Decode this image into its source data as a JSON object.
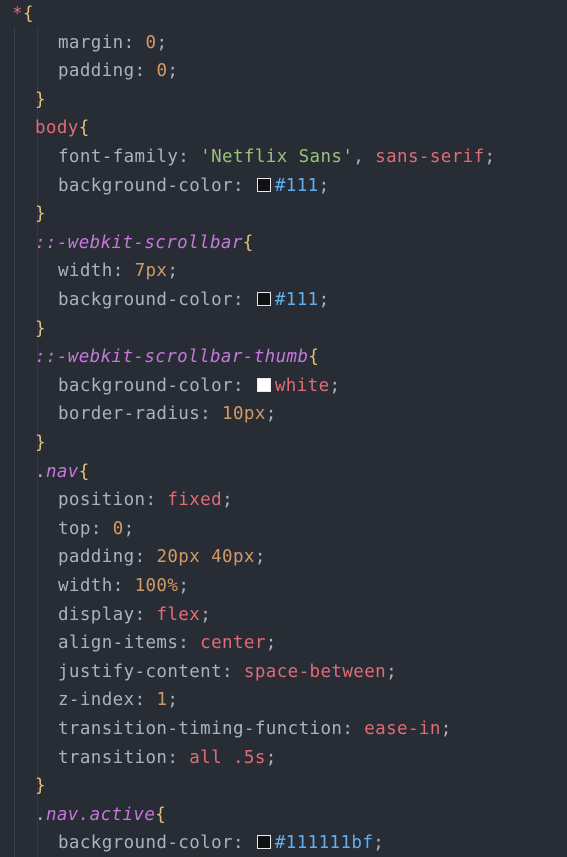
{
  "lines": [
    {
      "indent": 0,
      "tokens": [
        {
          "t": "*",
          "c": "sel-star"
        },
        {
          "t": "{",
          "c": "brace"
        }
      ]
    },
    {
      "indent": 1,
      "tokens": [
        {
          "t": "margin",
          "c": "prop"
        },
        {
          "t": ": ",
          "c": "punc"
        },
        {
          "t": "0",
          "c": "num"
        },
        {
          "t": ";",
          "c": "punc"
        }
      ]
    },
    {
      "indent": 1,
      "tokens": [
        {
          "t": "padding",
          "c": "prop"
        },
        {
          "t": ": ",
          "c": "punc"
        },
        {
          "t": "0",
          "c": "num"
        },
        {
          "t": ";",
          "c": "punc"
        }
      ]
    },
    {
      "indent": 0,
      "tokens": [
        {
          "t": "}",
          "c": "brace"
        }
      ]
    },
    {
      "indent": 0,
      "tokens": [
        {
          "t": "body",
          "c": "sel-tag"
        },
        {
          "t": "{",
          "c": "brace"
        }
      ]
    },
    {
      "indent": 1,
      "tokens": [
        {
          "t": "font-family",
          "c": "prop"
        },
        {
          "t": ": ",
          "c": "punc"
        },
        {
          "t": "'Netflix Sans'",
          "c": "str"
        },
        {
          "t": ", ",
          "c": "punc"
        },
        {
          "t": "sans-serif",
          "c": "kw"
        },
        {
          "t": ";",
          "c": "punc"
        }
      ]
    },
    {
      "indent": 1,
      "tokens": [
        {
          "t": "background-color",
          "c": "prop"
        },
        {
          "t": ": ",
          "c": "punc"
        },
        {
          "swatch": "#111111"
        },
        {
          "t": "#111",
          "c": "hex"
        },
        {
          "t": ";",
          "c": "punc"
        }
      ]
    },
    {
      "indent": 0,
      "tokens": [
        {
          "t": "}",
          "c": "brace"
        }
      ]
    },
    {
      "indent": 0,
      "tokens": [
        {
          "t": "::-webkit-scrollbar",
          "c": "sel-pseudo"
        },
        {
          "t": "{",
          "c": "brace"
        }
      ]
    },
    {
      "indent": 1,
      "tokens": [
        {
          "t": "width",
          "c": "prop"
        },
        {
          "t": ": ",
          "c": "punc"
        },
        {
          "t": "7px",
          "c": "num"
        },
        {
          "t": ";",
          "c": "punc"
        }
      ]
    },
    {
      "indent": 1,
      "tokens": [
        {
          "t": "background-color",
          "c": "prop"
        },
        {
          "t": ": ",
          "c": "punc"
        },
        {
          "swatch": "#111111"
        },
        {
          "t": "#111",
          "c": "hex"
        },
        {
          "t": ";",
          "c": "punc"
        }
      ]
    },
    {
      "indent": 0,
      "tokens": [
        {
          "t": "}",
          "c": "brace"
        }
      ]
    },
    {
      "indent": 0,
      "tokens": [
        {
          "t": "::-webkit-scrollbar-thumb",
          "c": "sel-pseudo"
        },
        {
          "t": "{",
          "c": "brace"
        }
      ]
    },
    {
      "indent": 1,
      "tokens": [
        {
          "t": "background-color",
          "c": "prop"
        },
        {
          "t": ": ",
          "c": "punc"
        },
        {
          "swatch": "#ffffff"
        },
        {
          "t": "white",
          "c": "kw"
        },
        {
          "t": ";",
          "c": "punc"
        }
      ]
    },
    {
      "indent": 1,
      "tokens": [
        {
          "t": "border-radius",
          "c": "prop"
        },
        {
          "t": ": ",
          "c": "punc"
        },
        {
          "t": "10px",
          "c": "num"
        },
        {
          "t": ";",
          "c": "punc"
        }
      ]
    },
    {
      "indent": 0,
      "tokens": [
        {
          "t": "}",
          "c": "brace"
        }
      ]
    },
    {
      "indent": 0,
      "tokens": [
        {
          "t": ".",
          "c": "dot"
        },
        {
          "t": "nav",
          "c": "sel-class"
        },
        {
          "t": "{",
          "c": "brace"
        }
      ]
    },
    {
      "indent": 1,
      "tokens": [
        {
          "t": "position",
          "c": "prop"
        },
        {
          "t": ": ",
          "c": "punc"
        },
        {
          "t": "fixed",
          "c": "kw"
        },
        {
          "t": ";",
          "c": "punc"
        }
      ]
    },
    {
      "indent": 1,
      "tokens": [
        {
          "t": "top",
          "c": "prop"
        },
        {
          "t": ": ",
          "c": "punc"
        },
        {
          "t": "0",
          "c": "num"
        },
        {
          "t": ";",
          "c": "punc"
        }
      ]
    },
    {
      "indent": 1,
      "tokens": [
        {
          "t": "padding",
          "c": "prop"
        },
        {
          "t": ": ",
          "c": "punc"
        },
        {
          "t": "20px 40px",
          "c": "num"
        },
        {
          "t": ";",
          "c": "punc"
        }
      ]
    },
    {
      "indent": 1,
      "tokens": [
        {
          "t": "width",
          "c": "prop"
        },
        {
          "t": ": ",
          "c": "punc"
        },
        {
          "t": "100%",
          "c": "num"
        },
        {
          "t": ";",
          "c": "punc"
        }
      ]
    },
    {
      "indent": 1,
      "tokens": [
        {
          "t": "display",
          "c": "prop"
        },
        {
          "t": ": ",
          "c": "punc"
        },
        {
          "t": "flex",
          "c": "kw"
        },
        {
          "t": ";",
          "c": "punc"
        }
      ]
    },
    {
      "indent": 1,
      "tokens": [
        {
          "t": "align-items",
          "c": "prop"
        },
        {
          "t": ": ",
          "c": "punc"
        },
        {
          "t": "center",
          "c": "kw"
        },
        {
          "t": ";",
          "c": "punc"
        }
      ]
    },
    {
      "indent": 1,
      "tokens": [
        {
          "t": "justify-content",
          "c": "prop"
        },
        {
          "t": ": ",
          "c": "punc"
        },
        {
          "t": "space-between",
          "c": "kw"
        },
        {
          "t": ";",
          "c": "punc"
        }
      ]
    },
    {
      "indent": 1,
      "tokens": [
        {
          "t": "z-index",
          "c": "prop"
        },
        {
          "t": ": ",
          "c": "punc"
        },
        {
          "t": "1",
          "c": "num"
        },
        {
          "t": ";",
          "c": "punc"
        }
      ]
    },
    {
      "indent": 1,
      "tokens": [
        {
          "t": "transition-timing-function",
          "c": "prop"
        },
        {
          "t": ": ",
          "c": "punc"
        },
        {
          "t": "ease-in",
          "c": "kw"
        },
        {
          "t": ";",
          "c": "punc"
        }
      ]
    },
    {
      "indent": 1,
      "tokens": [
        {
          "t": "transition",
          "c": "prop"
        },
        {
          "t": ": ",
          "c": "punc"
        },
        {
          "t": "all .5s",
          "c": "kw"
        },
        {
          "t": ";",
          "c": "punc"
        }
      ]
    },
    {
      "indent": 0,
      "tokens": [
        {
          "t": "}",
          "c": "brace"
        }
      ]
    },
    {
      "indent": 0,
      "tokens": [
        {
          "t": ".",
          "c": "dot"
        },
        {
          "t": "nav.active",
          "c": "sel-class"
        },
        {
          "t": "{",
          "c": "brace"
        }
      ]
    },
    {
      "indent": 1,
      "tokens": [
        {
          "t": "background-color",
          "c": "prop"
        },
        {
          "t": ": ",
          "c": "punc"
        },
        {
          "swatch": "#111111"
        },
        {
          "t": "#111111bf",
          "c": "hex"
        },
        {
          "t": ";",
          "c": "punc"
        }
      ]
    }
  ]
}
